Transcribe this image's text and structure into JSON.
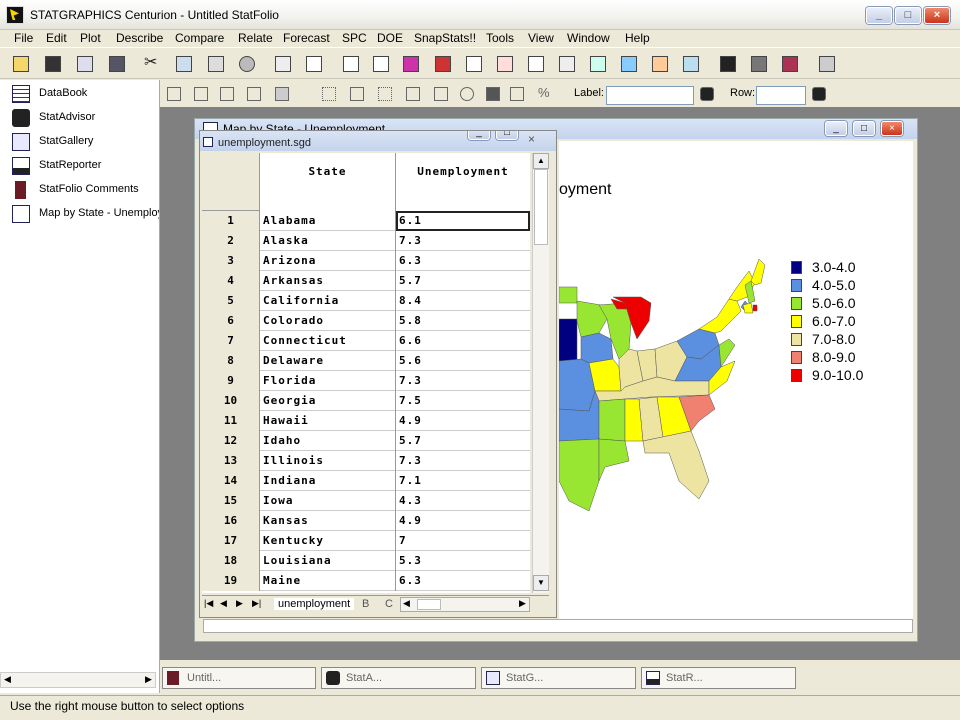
{
  "app": {
    "title": "STATGRAPHICS Centurion - Untitled StatFolio"
  },
  "window_buttons": {
    "minimize": "_",
    "maximize": "□",
    "close": "×"
  },
  "menu": [
    "File",
    "Edit",
    "Plot",
    "Describe",
    "Compare",
    "Relate",
    "Forecast",
    "SPC",
    "DOE",
    "SnapStats!!",
    "Tools",
    "View",
    "Window",
    "Help"
  ],
  "toolbar2": {
    "label_caption": "Label:",
    "label_value": "",
    "row_caption": "Row:",
    "row_value": ""
  },
  "left_panel": [
    {
      "label": "DataBook",
      "icon": "databook-icon"
    },
    {
      "label": "StatAdvisor",
      "icon": "statadvisor-icon"
    },
    {
      "label": "StatGallery",
      "icon": "statgallery-icon"
    },
    {
      "label": "StatReporter",
      "icon": "statreporter-icon"
    },
    {
      "label": "StatFolio Comments",
      "icon": "comments-icon"
    },
    {
      "label": "Map by State - Unemploy",
      "icon": "map-icon"
    }
  ],
  "map_window": {
    "title": "Map by State - Unemployment",
    "chart_title_fragment": "oyment",
    "legend": [
      {
        "label": "3.0-4.0",
        "color": "#000080"
      },
      {
        "label": "4.0-5.0",
        "color": "#5b8fe0"
      },
      {
        "label": "5.0-6.0",
        "color": "#99e632"
      },
      {
        "label": "6.0-7.0",
        "color": "#ffff00"
      },
      {
        "label": "7.0-8.0",
        "color": "#ece4a0"
      },
      {
        "label": "8.0-9.0",
        "color": "#f08070"
      },
      {
        "label": "9.0-10.0",
        "color": "#ee0000"
      }
    ]
  },
  "data_window": {
    "title": "unemployment.sgd",
    "headers": {
      "state": "State",
      "unemployment": "Unemployment"
    },
    "rows": [
      {
        "n": "1",
        "state": "Alabama",
        "value": "6.1"
      },
      {
        "n": "2",
        "state": "Alaska",
        "value": "7.3"
      },
      {
        "n": "3",
        "state": "Arizona",
        "value": "6.3"
      },
      {
        "n": "4",
        "state": "Arkansas",
        "value": "5.7"
      },
      {
        "n": "5",
        "state": "California",
        "value": "8.4"
      },
      {
        "n": "6",
        "state": "Colorado",
        "value": "5.8"
      },
      {
        "n": "7",
        "state": "Connecticut",
        "value": "6.6"
      },
      {
        "n": "8",
        "state": "Delaware",
        "value": "5.6"
      },
      {
        "n": "9",
        "state": "Florida",
        "value": "7.3"
      },
      {
        "n": "10",
        "state": "Georgia",
        "value": "7.5"
      },
      {
        "n": "11",
        "state": "Hawaii",
        "value": "4.9"
      },
      {
        "n": "12",
        "state": "Idaho",
        "value": "5.7"
      },
      {
        "n": "13",
        "state": "Illinois",
        "value": "7.3"
      },
      {
        "n": "14",
        "state": "Indiana",
        "value": "7.1"
      },
      {
        "n": "15",
        "state": "Iowa",
        "value": "4.3"
      },
      {
        "n": "16",
        "state": "Kansas",
        "value": "4.9"
      },
      {
        "n": "17",
        "state": "Kentucky",
        "value": "7"
      },
      {
        "n": "18",
        "state": "Louisiana",
        "value": "5.3"
      },
      {
        "n": "19",
        "state": "Maine",
        "value": "6.3"
      }
    ],
    "sheet_tabs": [
      "unemployment",
      "B",
      "C"
    ]
  },
  "taskbar": [
    {
      "label": "Untitl...",
      "icon": "statfolio-icon"
    },
    {
      "label": "StatA...",
      "icon": "statadvisor-icon"
    },
    {
      "label": "StatG...",
      "icon": "statgallery-icon"
    },
    {
      "label": "StatR...",
      "icon": "statreporter-icon"
    }
  ],
  "status": {
    "text": "Use the right mouse button to select options"
  }
}
